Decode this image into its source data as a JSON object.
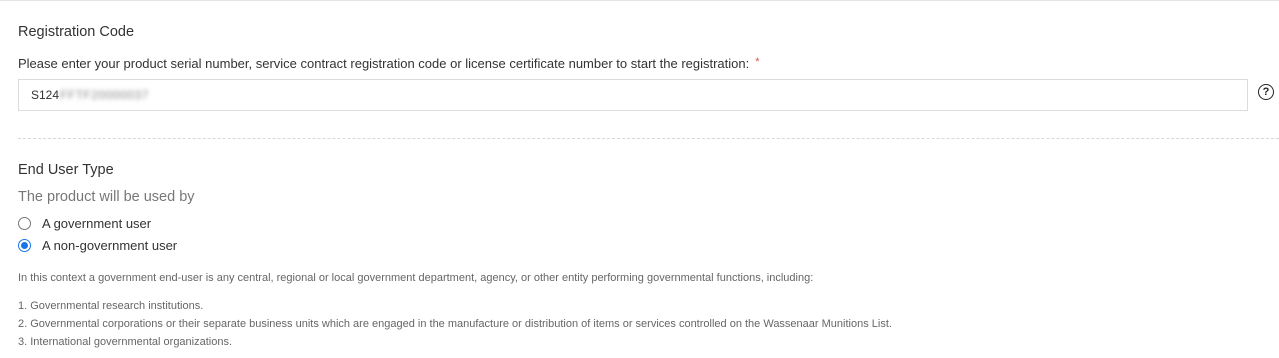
{
  "registration": {
    "title": "Registration Code",
    "prompt": "Please enter your product serial number, service contract registration code or license certificate number to start the registration:",
    "required_mark": "*",
    "code_prefix": "S124",
    "code_obscured": "FFTF20000037",
    "help_symbol": "?"
  },
  "end_user": {
    "title": "End User Type",
    "subtitle": "The product will be used by",
    "options": [
      {
        "label": "A government user",
        "checked": false
      },
      {
        "label": "A non-government user",
        "checked": true
      }
    ],
    "description": "In this context a government end-user is any central, regional or local government department, agency, or other entity performing governmental functions, including:",
    "list": [
      "1. Governmental research institutions.",
      "2. Governmental corporations or their separate business units which are engaged in the manufacture or distribution of items or services controlled on the Wassenaar Munitions List.",
      "3. International governmental organizations."
    ]
  },
  "colors": {
    "accent": "#1a73e8",
    "required": "#d9534f"
  }
}
